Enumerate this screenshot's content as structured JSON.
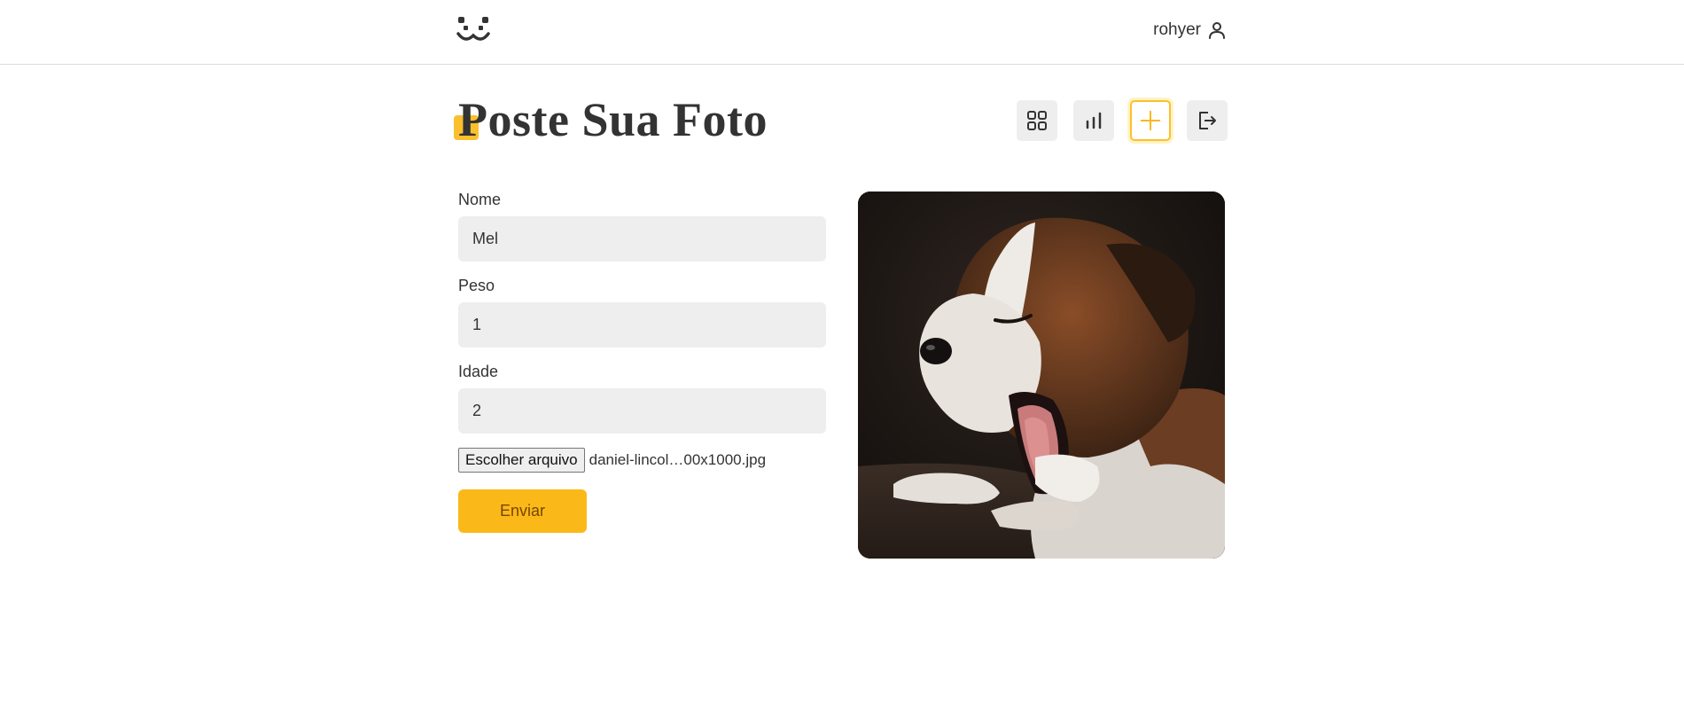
{
  "header": {
    "logo_icon": "dog-face-logo-icon",
    "username": "rohyer",
    "user_icon": "user-icon"
  },
  "page": {
    "title": "Poste Sua Foto",
    "accent_color": "#fbc02d"
  },
  "nav": [
    {
      "icon": "grid-icon",
      "active": false
    },
    {
      "icon": "bar-chart-icon",
      "active": false
    },
    {
      "icon": "plus-icon",
      "active": true
    },
    {
      "icon": "logout-icon",
      "active": false
    }
  ],
  "form": {
    "fields": [
      {
        "label": "Nome",
        "value": "Mel"
      },
      {
        "label": "Peso",
        "value": "1"
      },
      {
        "label": "Idade",
        "value": "2"
      }
    ],
    "file_button_label": "Escolher arquivo",
    "file_name": "daniel-lincol…00x1000.jpg",
    "submit_label": "Enviar",
    "submit_color": "#fbb919"
  },
  "preview": {
    "subject": "yawning-puppy-photo"
  }
}
